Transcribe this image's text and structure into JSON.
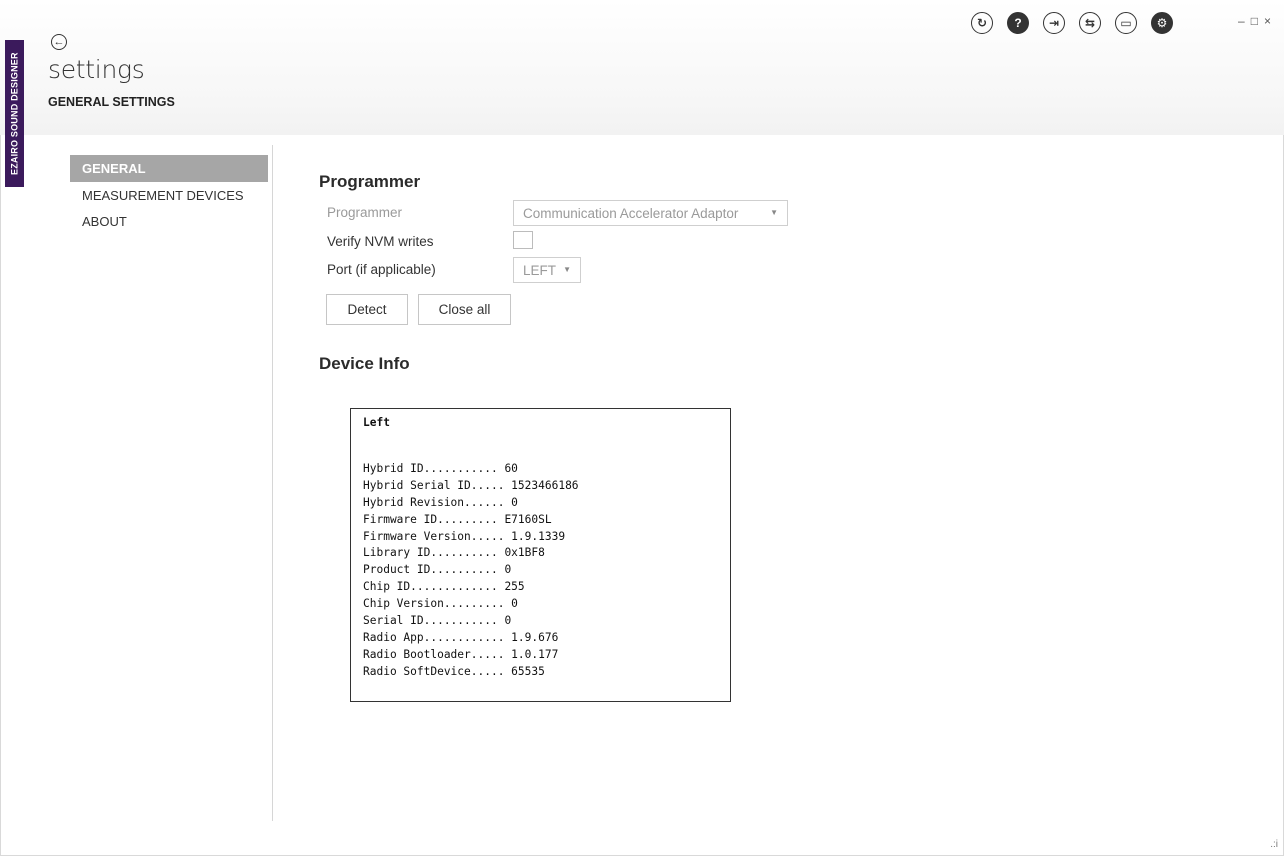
{
  "app": {
    "brand": "EZAIRO SOUND DESIGNER",
    "title": "settings",
    "subtitle": "GENERAL SETTINGS"
  },
  "toolbar": {
    "icons": [
      "refresh-icon",
      "help-icon",
      "login-icon",
      "sync-icon",
      "terminal-icon",
      "gear-icon"
    ],
    "window_controls": {
      "minimize": "–",
      "maximize": "□",
      "close": "×"
    }
  },
  "nav": {
    "items": [
      {
        "label": "GENERAL",
        "active": true
      },
      {
        "label": "MEASUREMENT DEVICES",
        "active": false
      },
      {
        "label": "ABOUT",
        "active": false
      }
    ]
  },
  "programmer": {
    "section_title": "Programmer",
    "programmer_label": "Programmer",
    "programmer_value": "Communication Accelerator Adaptor",
    "verify_label": "Verify NVM writes",
    "verify_checked": false,
    "port_label": "Port (if applicable)",
    "port_value": "LEFT",
    "detect_button": "Detect",
    "close_all_button": "Close all"
  },
  "device_info": {
    "section_title": "Device Info",
    "side": "Left",
    "rows": [
      "Hybrid ID........... 60",
      "Hybrid Serial ID..... 1523466186",
      "Hybrid Revision...... 0",
      "Firmware ID......... E7160SL",
      "Firmware Version..... 1.9.1339",
      "Library ID.......... 0x1BF8",
      "Product ID.......... 0",
      "Chip ID............. 255",
      "Chip Version......... 0",
      "Serial ID........... 0",
      "Radio App............ 1.9.676",
      "Radio Bootloader..... 1.0.177",
      "Radio SoftDevice..... 65535"
    ]
  },
  "colors": {
    "brand_strip": "#3b1a5c",
    "nav_active": "#a6a6a6"
  }
}
